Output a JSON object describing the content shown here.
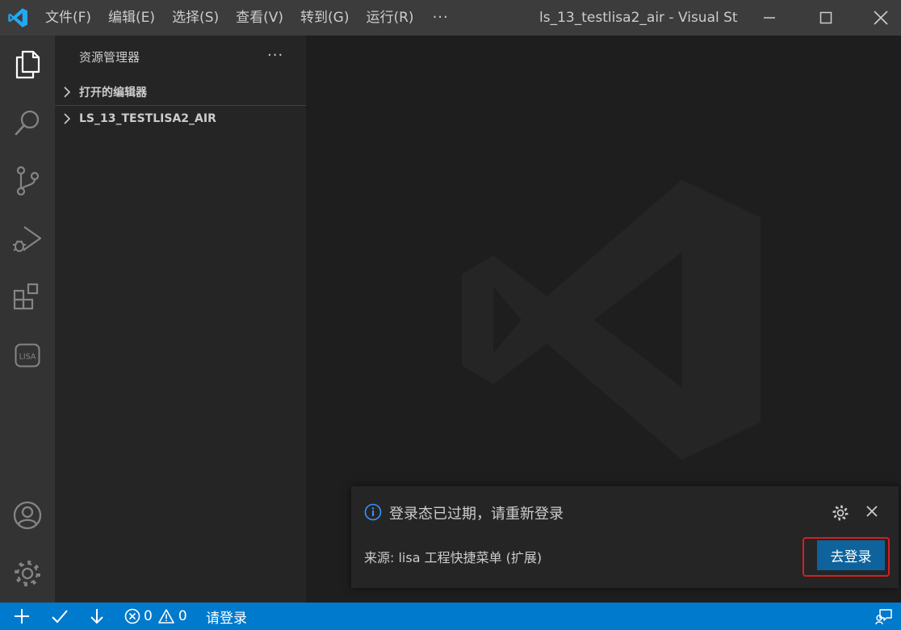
{
  "menu": {
    "items": [
      "文件(F)",
      "编辑(E)",
      "选择(S)",
      "查看(V)",
      "转到(G)",
      "运行(R)"
    ],
    "more": "···"
  },
  "window": {
    "title": "ls_13_testlisa2_air - Visual Stu..."
  },
  "activity_bar": {
    "items": [
      "explorer-icon",
      "search-icon",
      "source-control-icon",
      "run-debug-icon",
      "extensions-icon",
      "lisa-icon"
    ],
    "lisa_label": "LISA",
    "bottom": [
      "account-icon",
      "settings-gear-icon"
    ]
  },
  "sidebar": {
    "title": "资源管理器",
    "more": "···",
    "sections": [
      {
        "label": "打开的编辑器"
      },
      {
        "label": "LS_13_TESTLISA2_AIR"
      }
    ]
  },
  "notification": {
    "message": "登录态已过期，请重新登录",
    "source": "来源: lisa 工程快捷菜单 (扩展)",
    "action_label": "去登录"
  },
  "statusbar": {
    "errors": "0",
    "warnings": "0",
    "login_text": "请登录"
  },
  "colors": {
    "accent": "#007acc",
    "titlebar": "#3c3c3c",
    "activity_bar": "#333333",
    "sidebar": "#252526",
    "editor": "#1e1e1e",
    "button": "#0e639c",
    "highlight": "#d81e1e",
    "info": "#3794ff"
  }
}
